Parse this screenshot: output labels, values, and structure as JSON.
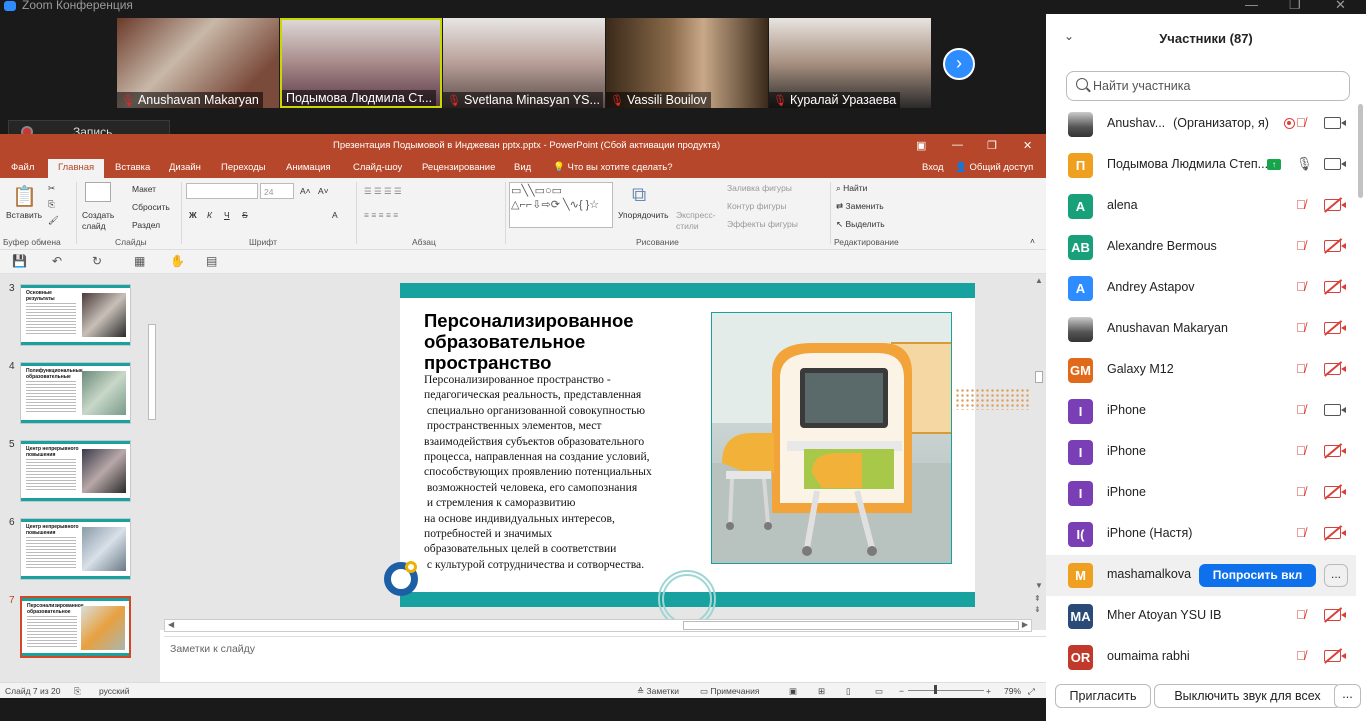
{
  "window": {
    "title": "Zoom Конференция"
  },
  "gallery": {
    "tiles": [
      {
        "name": "Anushavan Makaryan",
        "muted": true
      },
      {
        "name": "Подымова Людмила Ст...",
        "muted": false
      },
      {
        "name": "Svetlana Minasyan YS...",
        "muted": true
      },
      {
        "name": "Vassili Bouilov",
        "muted": true
      },
      {
        "name": "Куралай Уразаева",
        "muted": true
      }
    ],
    "next_icon": "chevron-right-icon"
  },
  "recording": {
    "label": "Запись..."
  },
  "powerpoint": {
    "title": "Презентация Подымовой  в Инджеван pptx.pptx - PowerPoint (Сбой активации продукта)",
    "tabs": [
      "Файл",
      "Главная",
      "Вставка",
      "Дизайн",
      "Переходы",
      "Анимация",
      "Слайд-шоу",
      "Рецензирование",
      "Вид"
    ],
    "tell_me": "Что вы хотите сделать?",
    "signin": "Вход",
    "share": "Общий доступ",
    "ribbon": {
      "paste": "Вставить",
      "clipboard": "Буфер обмена",
      "new_slide": "Создать слайд",
      "layout": "Макет",
      "reset": "Сбросить",
      "section": "Раздел",
      "slides_group": "Слайды",
      "font_size": "24",
      "font_group": "Шрифт",
      "paragraph_group": "Абзац",
      "arrange": "Упорядочить",
      "quick_styles": "Экспресс-стили",
      "shape_fill": "Заливка фигуры",
      "shape_outline": "Контур фигуры",
      "shape_effects": "Эффекты фигуры",
      "drawing_group": "Рисование",
      "find": "Найти",
      "replace": "Заменить",
      "select": "Выделить",
      "editing_group": "Редактирование"
    },
    "thumbnails": [
      {
        "num": "3",
        "title": "Основные результаты"
      },
      {
        "num": "4",
        "title": "Полифункциональные образовательные пространства"
      },
      {
        "num": "5",
        "title": "Центр непрерывного повышения мастерства педагогических работников"
      },
      {
        "num": "6",
        "title": "Центр непрерывного повышения мастерства"
      },
      {
        "num": "7",
        "title": "Персонализированное образовательное пространство"
      }
    ],
    "slide": {
      "title": "Персонализированное образовательное пространство",
      "body": "Персонализированное пространство -\nпедагогическая реальность, представленная\n специально организованной совокупностью\n пространственных элементов, мест\nвзаимодействия субъектов образовательного\nпроцесса, направленная на создание условий,\nспособствующих проявлению потенциальных\n возможностей человека, его самопознания\n и стремления к саморазвитию\nна основе индивидуальных интересов,\nпотребностей и значимых\nобразовательных целей в соответствии\n с культурой сотрудничества и сотворчества."
    },
    "notes_placeholder": "Заметки к слайду",
    "status": {
      "slide": "Слайд 7 из 20",
      "language": "русский",
      "notes": "Заметки",
      "comments": "Примечания",
      "zoom": "79%"
    }
  },
  "participants_panel": {
    "title": "Участники (87)",
    "search_placeholder": "Найти участника",
    "participants": [
      {
        "initials": "",
        "photo": true,
        "name": "Anushav...",
        "role": "(Организатор, я)",
        "color": "",
        "recording": true,
        "mic": "muted",
        "cam": "on"
      },
      {
        "initials": "П",
        "name": "Подымова Людмила Степ...",
        "color": "#f0a020",
        "sharing": true,
        "mic": "on",
        "cam": "on"
      },
      {
        "initials": "A",
        "name": "alena",
        "color": "#18a07a",
        "mic": "muted",
        "cam": "off"
      },
      {
        "initials": "AB",
        "name": "Alexandre Bermous",
        "color": "#18a07a",
        "mic": "muted",
        "cam": "off"
      },
      {
        "initials": "A",
        "name": "Andrey Astapov",
        "color": "#2d8cff",
        "mic": "muted",
        "cam": "off"
      },
      {
        "initials": "",
        "photo": true,
        "name": "Anushavan Makaryan",
        "color": "",
        "mic": "muted",
        "cam": "off"
      },
      {
        "initials": "GM",
        "name": "Galaxy M12",
        "color": "#e06a1a",
        "mic": "muted",
        "cam": "off"
      },
      {
        "initials": "I",
        "name": "iPhone",
        "color": "#7b3fb5",
        "mic": "muted",
        "cam": "on"
      },
      {
        "initials": "I",
        "name": "iPhone",
        "color": "#7b3fb5",
        "mic": "muted",
        "cam": "off"
      },
      {
        "initials": "I",
        "name": "iPhone",
        "color": "#7b3fb5",
        "mic": "muted",
        "cam": "off"
      },
      {
        "initials": "I(",
        "name": "iPhone (Настя)",
        "color": "#7b3fb5",
        "mic": "muted",
        "cam": "off"
      },
      {
        "initials": "M",
        "name": "mashamalkova",
        "color": "#f0a020",
        "ask": "Попросить вкл",
        "more": "...",
        "highlight": true
      },
      {
        "initials": "MA",
        "name": "Mher Atoyan YSU IB",
        "color": "#2a4a78",
        "mic": "muted",
        "cam": "off"
      },
      {
        "initials": "OR",
        "name": "oumaima rabhi",
        "color": "#c0392b",
        "mic": "muted",
        "cam": "off"
      }
    ],
    "invite": "Пригласить",
    "mute_all": "Выключить звук для всех",
    "more": "..."
  }
}
